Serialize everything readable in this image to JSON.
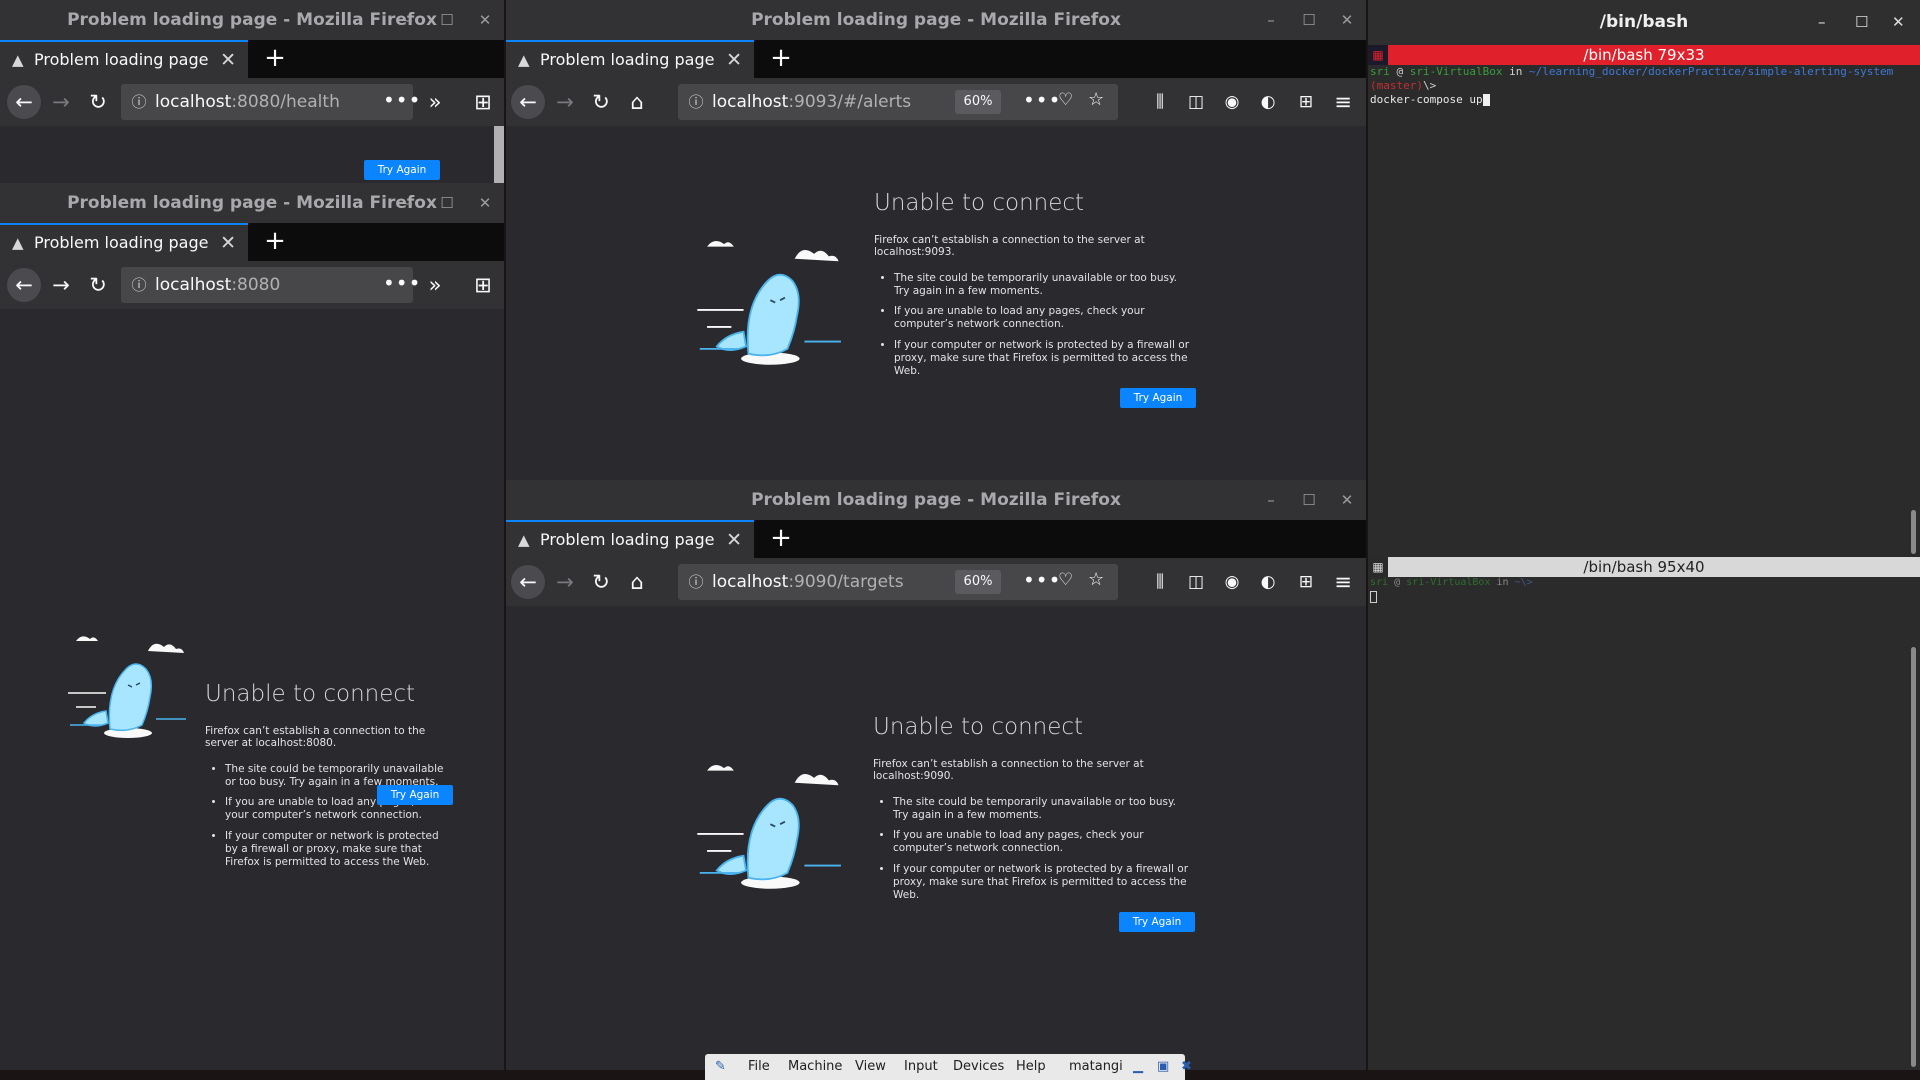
{
  "windows": {
    "w1": {
      "title": "Problem loading page - Mozilla Firefox",
      "tab": "Problem loading page",
      "host": "localhost",
      "path": ":8080/health",
      "try_again": "Try Again"
    },
    "w2": {
      "title": "Problem loading page - Mozilla Firefox",
      "tab": "Problem loading page",
      "host": "localhost",
      "path": ":8080",
      "heading": "Unable to connect",
      "desc": "Firefox can’t establish a connection to the server at localhost:8080.",
      "bullets": [
        "The site could be temporarily unavailable or too busy. Try again in a few moments.",
        "If you are unable to load any pages, check your computer’s network connection.",
        "If your computer or network is protected by a firewall or proxy, make sure that Firefox is permitted to access the Web."
      ],
      "try_again": "Try Again"
    },
    "w3": {
      "title": "Problem loading page - Mozilla Firefox",
      "tab": "Problem loading page",
      "host": "localhost",
      "path": ":9093/#/alerts",
      "zoom": "60%",
      "heading": "Unable to connect",
      "desc": "Firefox can’t establish a connection to the server at localhost:9093.",
      "bullets": [
        "The site could be temporarily unavailable or too busy. Try again in a few moments.",
        "If you are unable to load any pages, check your computer’s network connection.",
        "If your computer or network is protected by a firewall or proxy, make sure that Firefox is permitted to access the Web."
      ],
      "try_again": "Try Again"
    },
    "w4": {
      "title": "Problem loading page - Mozilla Firefox",
      "tab": "Problem loading page",
      "host": "localhost",
      "path": ":9090/targets",
      "zoom": "60%",
      "heading": "Unable to connect",
      "desc": "Firefox can’t establish a connection to the server at localhost:9090.",
      "bullets": [
        "The site could be temporarily unavailable or too busy. Try again in a few moments.",
        "If you are unable to load any pages, check your computer’s network connection.",
        "If your computer or network is protected by a firewall or proxy, make sure that Firefox is permitted to access the Web."
      ],
      "try_again": "Try Again"
    }
  },
  "terminal": {
    "title": "/bin/bash",
    "pane1": {
      "header": "/bin/bash 79x33",
      "user": "sri",
      "at": "@",
      "host": "sri-VirtualBox",
      "in": "in",
      "cwd": "~/learning_docker/dockerPractice/simple-alerting-system",
      "branch": "(master)",
      "prompt": "\\>",
      "command": "docker-compose up"
    },
    "pane2": {
      "header": "/bin/bash 95x40",
      "user": "sri",
      "at": "@",
      "host": "sri-VirtualBox",
      "in": "in",
      "cwd": "~\\>"
    }
  },
  "vbox_menu": {
    "items": [
      "File",
      "Machine",
      "View",
      "Input",
      "Devices",
      "Help"
    ],
    "vm_name": "matangi"
  },
  "colors": {
    "accent": "#0a84ff",
    "terminal_active": "#e0202a",
    "terminal_inactive": "#d8d8d8"
  }
}
